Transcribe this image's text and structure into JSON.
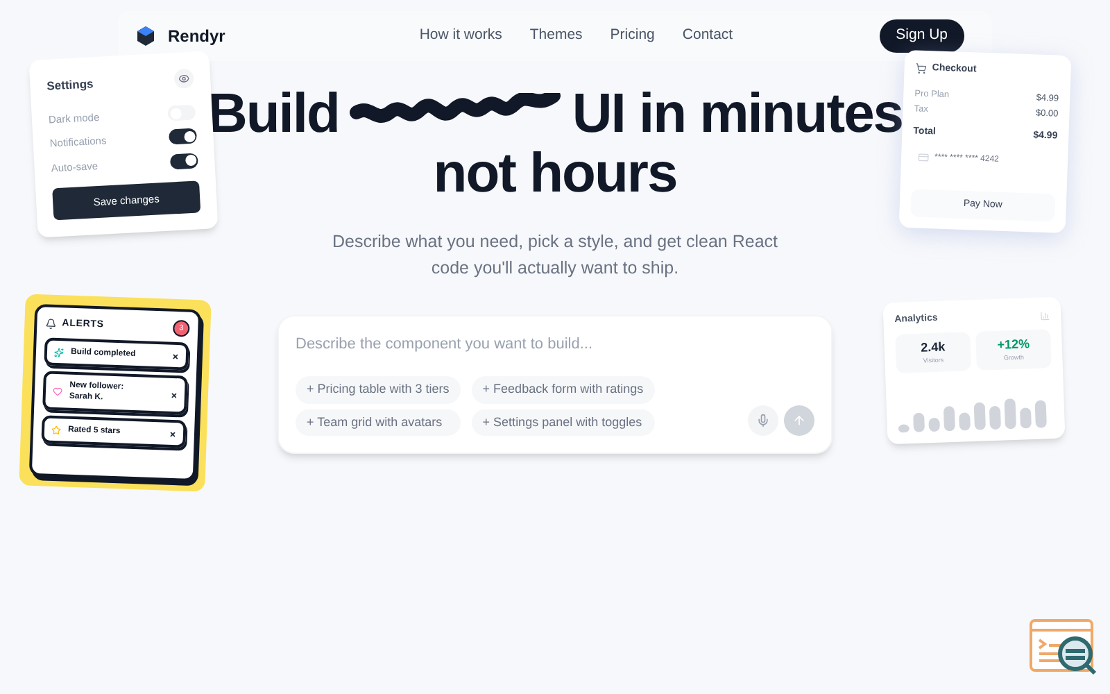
{
  "nav": {
    "brand": "Rendyr",
    "links": [
      "How it works",
      "Themes",
      "Pricing",
      "Contact"
    ],
    "cta": "Sign Up"
  },
  "hero": {
    "title_start": "Build",
    "title_end": "UI in minutes",
    "title_line2": "not hours",
    "subtitle": "Describe what you need, pick a style, and get clean React code you'll actually want to ship."
  },
  "prompt": {
    "placeholder": "Describe the component you want to build...",
    "suggestions": [
      "+ Pricing table with 3 tiers",
      "+ Feedback form with ratings",
      "+ Team grid with avatars",
      "+ Settings panel with toggles"
    ]
  },
  "settings_card": {
    "title": "Settings",
    "toggles": [
      {
        "label": "Dark mode",
        "on": false
      },
      {
        "label": "Notifications",
        "on": true
      },
      {
        "label": "Auto-save",
        "on": true
      }
    ],
    "button": "Save changes"
  },
  "checkout_card": {
    "title": "Checkout",
    "lines": [
      {
        "label": "Pro Plan",
        "value": "$4.99",
        "kind": "normal"
      },
      {
        "label": "Tax",
        "value": "$0.00",
        "kind": "normal"
      },
      {
        "label": "Total",
        "value": "$4.99",
        "kind": "total"
      }
    ],
    "card_number": "**** **** **** 4242",
    "button": "Pay Now"
  },
  "alerts_card": {
    "title": "ALERTS",
    "badge": "3",
    "items": [
      {
        "text": "Build completed",
        "kind": "sparkle"
      },
      {
        "text": "New follower: Sarah K.",
        "kind": "heart"
      },
      {
        "text": "Rated 5 stars",
        "kind": "star"
      }
    ]
  },
  "analytics_card": {
    "title": "Analytics",
    "stats": [
      {
        "value": "2.4k",
        "label": "Visitors",
        "kind": "neutral"
      },
      {
        "value": "+12%",
        "label": "Growth",
        "kind": "positive"
      }
    ]
  }
}
